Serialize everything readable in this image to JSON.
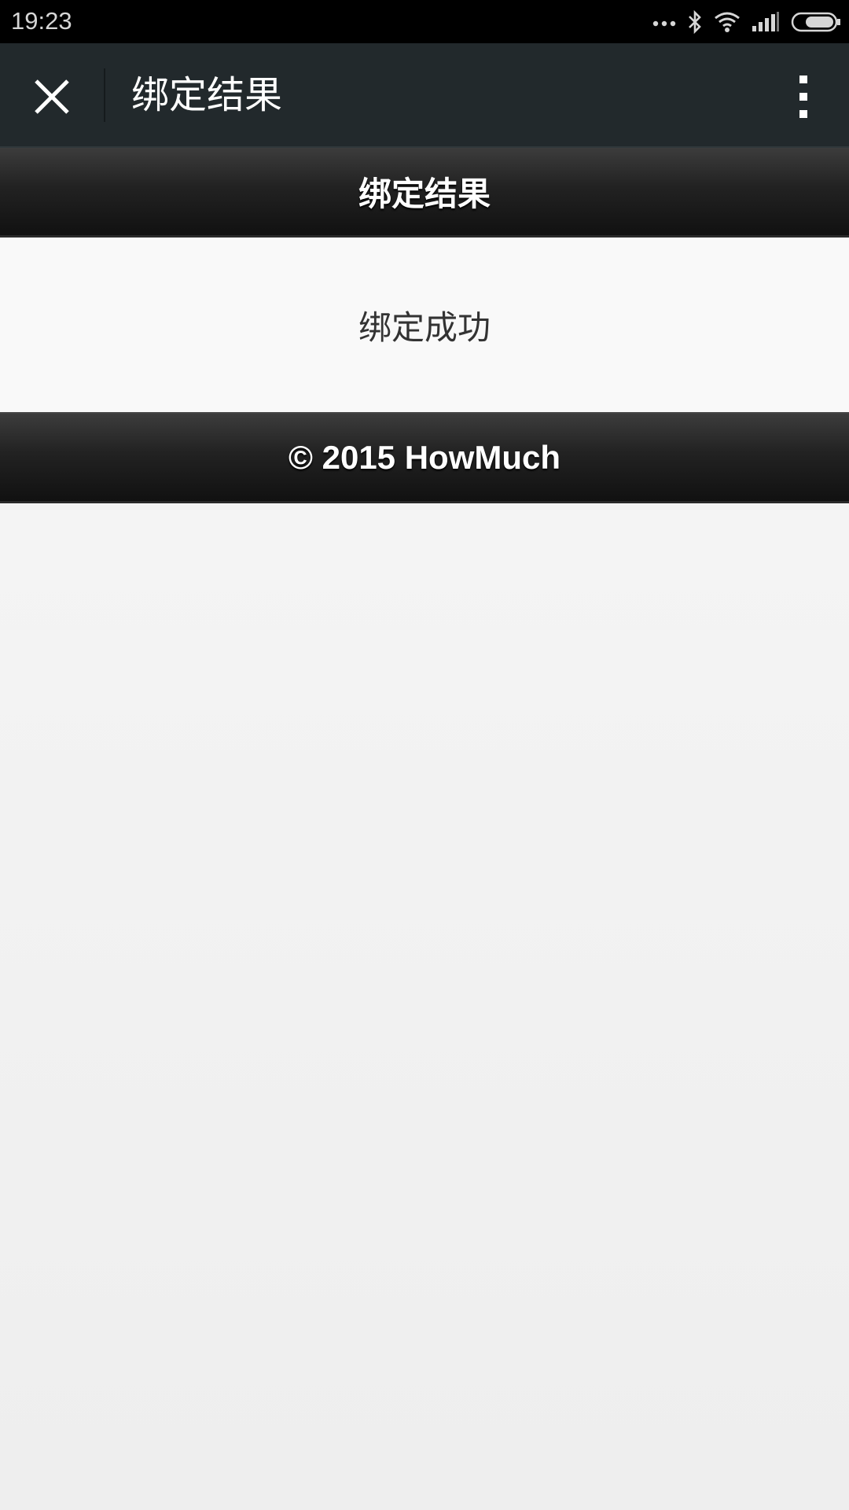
{
  "status_bar": {
    "time": "19:23",
    "icons": [
      "more-dots-icon",
      "bluetooth-icon",
      "wifi-icon",
      "signal-icon",
      "battery-icon"
    ]
  },
  "title_bar": {
    "title": "绑定结果",
    "close_icon": "close-icon",
    "more_icon": "more-vertical-icon"
  },
  "page": {
    "header_title": "绑定结果",
    "message": "绑定成功",
    "footer_text": "© 2015 HowMuch"
  },
  "colors": {
    "status_bar_bg": "#000000",
    "title_bar_bg": "#22292c",
    "header_bg": "#222222",
    "content_bg": "#f9f9f9",
    "page_bg": "#f3f3f3"
  }
}
